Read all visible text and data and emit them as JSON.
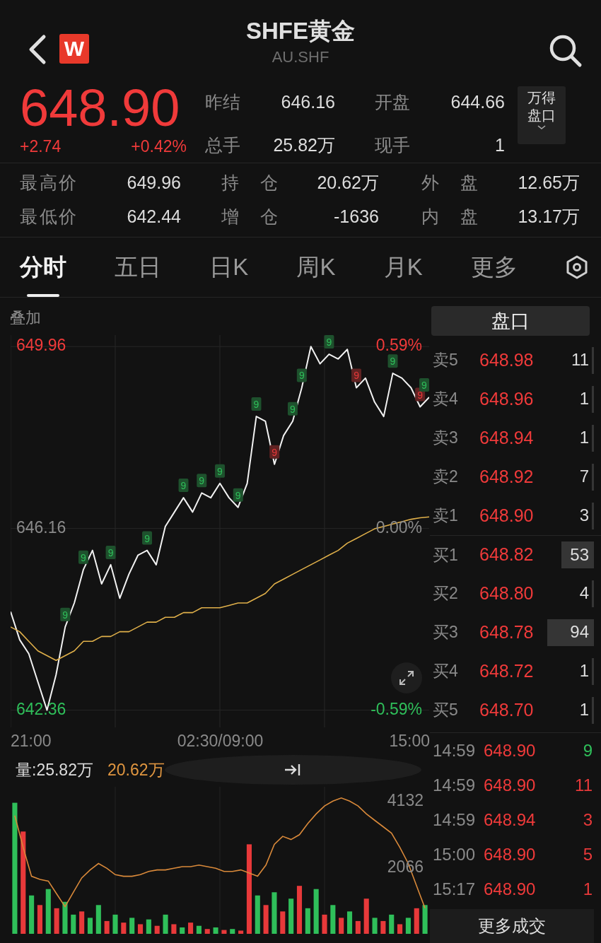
{
  "header": {
    "title": "SHFE黄金",
    "subtitle": "AU.SHF",
    "logo_text": "W"
  },
  "quote": {
    "price": "648.90",
    "change": "+2.74",
    "change_pct": "+0.42%"
  },
  "stats": [
    {
      "label": "昨结",
      "value": "646.16"
    },
    {
      "label": "开盘",
      "value": "644.66"
    },
    {
      "label": "总手",
      "value": "25.82万"
    },
    {
      "label": "现手",
      "value": "1"
    }
  ],
  "wind_button": {
    "label": "万得盘口"
  },
  "details": [
    {
      "label": "最高价",
      "value": "649.96"
    },
    {
      "label": "持 仓",
      "value": "20.62万"
    },
    {
      "label": "外 盘",
      "value": "12.65万"
    },
    {
      "label": "最低价",
      "value": "642.44"
    },
    {
      "label": "增 仓",
      "value": "-1636"
    },
    {
      "label": "内 盘",
      "value": "13.17万"
    }
  ],
  "tabs": [
    {
      "label": "分时",
      "selected": true
    },
    {
      "label": "五日",
      "selected": false
    },
    {
      "label": "日K",
      "selected": false
    },
    {
      "label": "周K",
      "selected": false
    },
    {
      "label": "月K",
      "selected": false
    },
    {
      "label": "更多",
      "selected": false
    }
  ],
  "overlay_label": "叠加",
  "price_chart": {
    "chart_data": {
      "type": "line",
      "ylim": [
        642.0,
        650.2
      ],
      "categories": [
        null,
        null,
        null,
        null,
        null,
        null,
        null,
        null,
        null,
        null,
        null,
        null,
        null,
        null,
        null,
        null,
        null,
        null,
        null,
        null,
        null,
        null,
        null,
        null,
        null,
        null,
        null,
        null,
        null,
        null,
        null,
        null,
        null,
        null,
        null,
        null,
        null,
        null,
        null,
        null,
        null,
        null,
        null,
        null,
        null,
        null,
        null
      ],
      "series": [
        {
          "color": "#f2f2f2",
          "values": [
            644.42,
            643.83,
            643.54,
            642.95,
            642.36,
            643.1,
            644.1,
            644.6,
            645.3,
            645.7,
            645.0,
            645.4,
            644.7,
            645.2,
            645.6,
            645.7,
            645.4,
            646.2,
            646.5,
            646.8,
            646.5,
            646.9,
            646.8,
            647.1,
            646.8,
            646.6,
            647.1,
            648.5,
            648.4,
            647.5,
            648.1,
            648.4,
            649.1,
            649.96,
            649.6,
            649.8,
            649.7,
            649.9,
            649.1,
            649.3,
            648.8,
            648.5,
            649.4,
            649.3,
            649.1,
            648.7,
            648.9
          ]
        },
        {
          "color": "#e0b04a",
          "values": [
            644.1,
            644.0,
            643.8,
            643.6,
            643.5,
            643.4,
            643.5,
            643.6,
            643.8,
            643.8,
            643.9,
            643.9,
            644.0,
            644.0,
            644.1,
            644.2,
            644.2,
            644.3,
            644.3,
            644.4,
            644.4,
            644.5,
            644.5,
            644.5,
            644.55,
            644.6,
            644.6,
            644.7,
            644.8,
            645.0,
            645.1,
            645.2,
            645.3,
            645.4,
            645.5,
            645.6,
            645.7,
            645.85,
            645.95,
            646.05,
            646.15,
            646.2,
            646.25,
            646.3,
            646.35,
            646.38,
            646.4
          ]
        }
      ],
      "yticks": [
        {
          "value": 649.96,
          "label": "649.96"
        },
        {
          "value": 646.16,
          "label": "646.16"
        },
        {
          "value": 642.36,
          "label": "642.36"
        }
      ],
      "grid": true
    },
    "signals": [
      {
        "text": "9",
        "color": "#2fbf5a"
      },
      {
        "text": "9",
        "color": "#2fbf5a"
      },
      {
        "text": "9",
        "color": "#2fbf5a"
      },
      {
        "text": "9",
        "color": "#2fbf5a"
      },
      {
        "text": "9",
        "color": "#2fbf5a"
      },
      {
        "text": "9",
        "color": "#2fbf5a"
      },
      {
        "text": "9",
        "color": "#2fbf5a"
      },
      {
        "text": "9",
        "color": "#2fbf5a"
      },
      {
        "text": "9",
        "color": "#2fbf5a"
      },
      {
        "text": "9",
        "color": "#e8393a"
      },
      {
        "text": "9",
        "color": "#2fbf5a"
      },
      {
        "text": "9",
        "color": "#2fbf5a"
      },
      {
        "text": "9",
        "color": "#2fbf5a"
      },
      {
        "text": "9",
        "color": "#e8393a"
      },
      {
        "text": "9",
        "color": "#2fbf5a"
      },
      {
        "text": "9",
        "color": "#e8393a"
      },
      {
        "text": "9",
        "color": "#2fbf5a"
      }
    ],
    "time_labels": [
      "21:00",
      "02:30/09:00",
      "15:00"
    ]
  },
  "percent_labels": [
    {
      "text": "0.59%",
      "kind": "up"
    },
    {
      "text": "0.00%",
      "kind": "flat"
    },
    {
      "text": "-0.59%",
      "kind": "down"
    }
  ],
  "volume": {
    "label": "量:25.82万",
    "open_interest": "20.62万",
    "chart_data": {
      "type": "bar",
      "stacked": true,
      "ylim": [
        0,
        4600
      ],
      "categories": [
        null,
        null,
        null,
        null,
        null,
        null,
        null,
        null,
        null,
        null,
        null,
        null,
        null,
        null,
        null,
        null,
        null,
        null,
        null,
        null,
        null,
        null,
        null,
        null,
        null,
        null,
        null,
        null,
        null,
        null,
        null,
        null,
        null,
        null,
        null,
        null,
        null,
        null,
        null,
        null,
        null,
        null,
        null,
        null,
        null,
        null,
        null,
        null,
        null,
        null
      ],
      "yticks": [
        {
          "value": 4132,
          "label": "4132"
        },
        {
          "value": 2066,
          "label": "2066"
        }
      ],
      "series": [
        {
          "color": "#e8393a",
          "values": [
            null,
            3200,
            null,
            900,
            null,
            800,
            null,
            null,
            700,
            null,
            null,
            400,
            null,
            350,
            null,
            300,
            null,
            250,
            null,
            300,
            null,
            350,
            null,
            150,
            null,
            120,
            null,
            100,
            2800,
            null,
            900,
            null,
            700,
            null,
            1500,
            null,
            null,
            600,
            null,
            500,
            null,
            400,
            1100,
            null,
            400,
            null,
            300,
            null,
            800,
            null
          ]
        },
        {
          "color": "#2fbf5a",
          "values": [
            4100,
            null,
            1200,
            null,
            1400,
            null,
            1000,
            600,
            null,
            500,
            900,
            null,
            600,
            null,
            500,
            null,
            450,
            null,
            600,
            null,
            200,
            null,
            250,
            null,
            200,
            null,
            150,
            null,
            null,
            1200,
            null,
            1300,
            null,
            1100,
            null,
            800,
            1400,
            null,
            900,
            null,
            700,
            null,
            null,
            500,
            null,
            600,
            null,
            500,
            null,
            900
          ]
        },
        {
          "type": "line",
          "color": "#d9893a",
          "values": [
            3700,
            2700,
            1800,
            1700,
            1650,
            1250,
            850,
            1300,
            1750,
            2000,
            2200,
            2050,
            1850,
            1800,
            1800,
            1850,
            1950,
            2000,
            2000,
            2050,
            2100,
            2100,
            2150,
            2100,
            2050,
            1950,
            1950,
            2000,
            1900,
            1800,
            2150,
            2800,
            3050,
            2950,
            3100,
            3450,
            3750,
            4000,
            4150,
            4250,
            4150,
            4000,
            3750,
            3550,
            3350,
            3150,
            2700,
            2200,
            1500,
            800
          ]
        }
      ]
    }
  },
  "order_book": {
    "title": "盘口",
    "rows": [
      {
        "label": "卖5",
        "price": "648.98",
        "qty": "11"
      },
      {
        "label": "卖4",
        "price": "648.96",
        "qty": "1"
      },
      {
        "label": "卖3",
        "price": "648.94",
        "qty": "1"
      },
      {
        "label": "卖2",
        "price": "648.92",
        "qty": "7"
      },
      {
        "label": "卖1",
        "price": "648.90",
        "qty": "3"
      },
      {
        "label": "买1",
        "price": "648.82",
        "qty": "53"
      },
      {
        "label": "买2",
        "price": "648.80",
        "qty": "4"
      },
      {
        "label": "买3",
        "price": "648.78",
        "qty": "94"
      },
      {
        "label": "买4",
        "price": "648.72",
        "qty": "1"
      },
      {
        "label": "买5",
        "price": "648.70",
        "qty": "1"
      }
    ]
  },
  "trades": [
    {
      "time": "14:59",
      "price": "648.90",
      "qty": "9",
      "color": "#2fbf5a"
    },
    {
      "time": "14:59",
      "price": "648.90",
      "qty": "11",
      "color": "#e8393a"
    },
    {
      "time": "14:59",
      "price": "648.94",
      "qty": "3",
      "color": "#e8393a"
    },
    {
      "time": "15:00",
      "price": "648.90",
      "qty": "5",
      "color": "#e8393a"
    },
    {
      "time": "15:17",
      "price": "648.90",
      "qty": "1",
      "color": "#e8393a"
    }
  ],
  "more_trades": "更多成交"
}
